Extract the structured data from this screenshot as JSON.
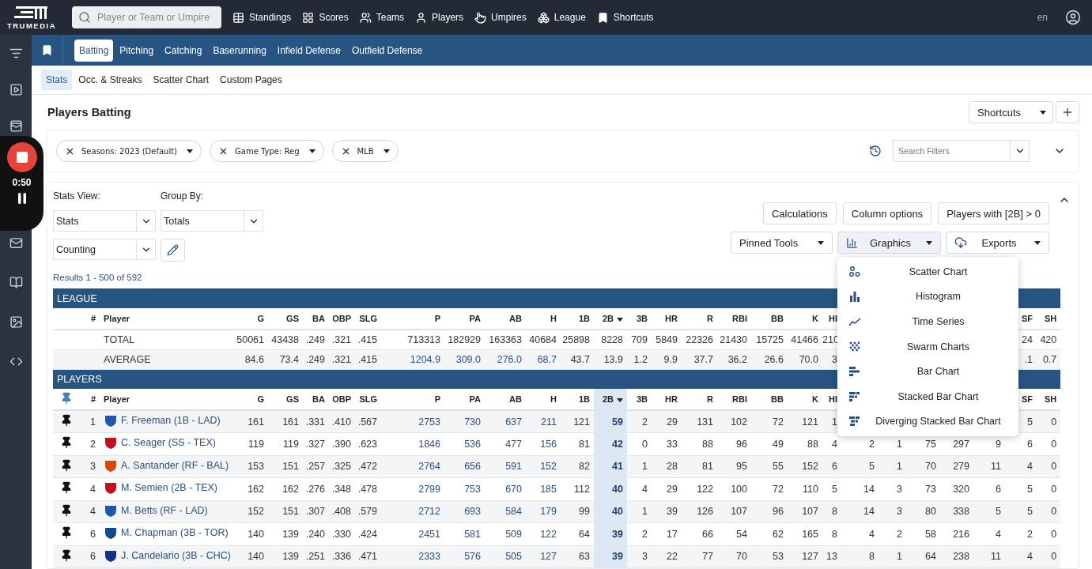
{
  "logo": "TRUMEDIA",
  "search": {
    "placeholder": "Player or Team or Umpire"
  },
  "top_nav": [
    {
      "label": "Standings"
    },
    {
      "label": "Scores"
    },
    {
      "label": "Teams"
    },
    {
      "label": "Players"
    },
    {
      "label": "Umpires"
    },
    {
      "label": "League"
    },
    {
      "label": "Shortcuts"
    }
  ],
  "language": "en",
  "recorder": {
    "time": "0:50"
  },
  "section_tabs": [
    {
      "label": "Batting",
      "selected": true
    },
    {
      "label": "Pitching",
      "selected": false
    },
    {
      "label": "Catching",
      "selected": false
    },
    {
      "label": "Baserunning",
      "selected": false
    },
    {
      "label": "Infield Defense",
      "selected": false
    },
    {
      "label": "Outfield Defense",
      "selected": false
    }
  ],
  "sub_tabs": [
    {
      "label": "Stats",
      "selected": true
    },
    {
      "label": "Occ. & Streaks",
      "selected": false
    },
    {
      "label": "Scatter Chart",
      "selected": false
    },
    {
      "label": "Custom Pages",
      "selected": false
    }
  ],
  "page_title": "Players Batting",
  "shortcuts_button": "Shortcuts",
  "filters": [
    {
      "label": "Seasons: 2023 (Default)"
    },
    {
      "label": "Game Type: Reg"
    },
    {
      "label": "MLB"
    }
  ],
  "filter_search": {
    "placeholder": "Search Filters"
  },
  "stats_view": {
    "label": "Stats View:",
    "value": "Stats"
  },
  "group_by": {
    "label": "Group By:",
    "value": "Totals"
  },
  "stat_type": {
    "value": "Counting"
  },
  "actions": [
    "Calculations",
    "Column options",
    "Players with [2B] > 0"
  ],
  "tools": [
    {
      "label": "Pinned Tools",
      "kind": "plain",
      "expanded": false
    },
    {
      "label": "Graphics",
      "kind": "graphics",
      "expanded": true
    },
    {
      "label": "Exports",
      "kind": "export",
      "expanded": false
    }
  ],
  "graphics_menu": [
    {
      "label": "Scatter Chart",
      "kind": "scatter"
    },
    {
      "label": "Histogram",
      "kind": "histogram"
    },
    {
      "label": "Time Series",
      "kind": "line"
    },
    {
      "label": "Swarm Charts",
      "kind": "swarm"
    },
    {
      "label": "Bar Chart",
      "kind": "bar"
    },
    {
      "label": "Stacked Bar Chart",
      "kind": "stacked"
    },
    {
      "label": "Diverging Stacked Bar Chart",
      "kind": "diverging"
    }
  ],
  "results": "Results 1 - 500 of 592",
  "league": {
    "title": "LEAGUE",
    "number_heading": "#",
    "player_heading": "Player",
    "columns": [
      {
        "label": "G",
        "sorted": false
      },
      {
        "label": "GS",
        "sorted": false
      },
      {
        "label": "BA",
        "sorted": false
      },
      {
        "label": "OBP",
        "sorted": false
      },
      {
        "label": "SLG",
        "sorted": false
      },
      {
        "label": "P",
        "sorted": false
      },
      {
        "label": "PA",
        "sorted": false
      },
      {
        "label": "AB",
        "sorted": false
      },
      {
        "label": "H",
        "sorted": false
      },
      {
        "label": "1B",
        "sorted": false
      },
      {
        "label": "2B",
        "sorted": true
      },
      {
        "label": "3B",
        "sorted": false
      },
      {
        "label": "HR",
        "sorted": false
      },
      {
        "label": "R",
        "sorted": false
      },
      {
        "label": "RBI",
        "sorted": false
      },
      {
        "label": "BB",
        "sorted": false
      },
      {
        "label": "K",
        "sorted": false
      },
      {
        "label": "HI",
        "sorted": false
      }
    ],
    "end_columns": [
      {
        "label": "SF",
        "sorted": false
      },
      {
        "label": "SH",
        "sorted": false
      }
    ],
    "rows": [
      {
        "kind": "total",
        "label": "TOTAL",
        "values": [
          "50061",
          "43438",
          ".249",
          ".321",
          ".415",
          "713313",
          "182929",
          "163363",
          "40684",
          "25898",
          "8228",
          "709",
          "5849",
          "22326",
          "21430",
          "15725",
          "41466",
          "210"
        ],
        "end_values": [
          "24",
          "420"
        ]
      },
      {
        "kind": "average",
        "label": "AVERAGE",
        "values": [
          "84.6",
          "73.4",
          ".249",
          ".321",
          ".415",
          "1204.9",
          "309.0",
          "276.0",
          "68.7",
          "43.7",
          "13.9",
          "1.2",
          "9.9",
          "37.7",
          "36.2",
          "26.6",
          "70.0",
          "3"
        ],
        "end_values": [
          ".1",
          "0.7"
        ]
      }
    ]
  },
  "players": {
    "title": "PLAYERS",
    "number_heading": "#",
    "player_heading": "Player",
    "columns": [
      {
        "label": "G",
        "sorted": false
      },
      {
        "label": "GS",
        "sorted": false
      },
      {
        "label": "BA",
        "sorted": false
      },
      {
        "label": "OBP",
        "sorted": false
      },
      {
        "label": "SLG",
        "sorted": false
      },
      {
        "label": "P",
        "sorted": false
      },
      {
        "label": "PA",
        "sorted": false
      },
      {
        "label": "AB",
        "sorted": false
      },
      {
        "label": "H",
        "sorted": false
      },
      {
        "label": "1B",
        "sorted": false
      },
      {
        "label": "2B",
        "sorted": true
      },
      {
        "label": "3B",
        "sorted": false
      },
      {
        "label": "HR",
        "sorted": false
      },
      {
        "label": "R",
        "sorted": false
      },
      {
        "label": "RBI",
        "sorted": false
      },
      {
        "label": "BB",
        "sorted": false
      },
      {
        "label": "K",
        "sorted": false
      },
      {
        "label": "HI",
        "sorted": false
      }
    ],
    "end_columns": [
      {
        "label": "SF",
        "sorted": false
      },
      {
        "label": "SH",
        "sorted": false
      }
    ],
    "rows": [
      {
        "rank": "1",
        "name": "F. Freeman (1B - LAD)",
        "color": "#1e5aa8",
        "pinned": true,
        "values": [
          "161",
          "161",
          ".331",
          ".410",
          ".567",
          "2753",
          "730",
          "637",
          "211",
          "121",
          "59",
          "2",
          "29",
          "131",
          "102",
          "72",
          "121",
          "1"
        ],
        "end_values": [
          "5",
          "0"
        ]
      },
      {
        "rank": "2",
        "name": "C. Seager (SS - TEX)",
        "color": "#c0111f",
        "pinned": true,
        "values": [
          "119",
          "119",
          ".327",
          ".390",
          ".623",
          "1846",
          "536",
          "477",
          "156",
          "81",
          "42",
          "0",
          "33",
          "88",
          "96",
          "49",
          "88",
          "4",
          "2",
          "1",
          "75",
          "297",
          "9"
        ],
        "end_values": [
          "6",
          "0"
        ]
      },
      {
        "rank": "3",
        "name": "A. Santander (RF - BAL)",
        "color": "#df4601",
        "pinned": true,
        "values": [
          "153",
          "151",
          ".257",
          ".325",
          ".472",
          "2764",
          "656",
          "591",
          "152",
          "82",
          "41",
          "1",
          "28",
          "81",
          "95",
          "55",
          "152",
          "6",
          "5",
          "1",
          "70",
          "279",
          "11"
        ],
        "end_values": [
          "4",
          "0"
        ]
      },
      {
        "rank": "4",
        "name": "M. Semien (2B - TEX)",
        "color": "#c0111f",
        "pinned": true,
        "values": [
          "162",
          "162",
          ".276",
          ".348",
          ".478",
          "2799",
          "753",
          "670",
          "185",
          "112",
          "40",
          "4",
          "29",
          "122",
          "100",
          "72",
          "110",
          "5",
          "14",
          "3",
          "73",
          "320",
          "6"
        ],
        "end_values": [
          "5",
          "0"
        ]
      },
      {
        "rank": "4",
        "name": "M. Betts (RF - LAD)",
        "color": "#1e5aa8",
        "pinned": true,
        "values": [
          "152",
          "151",
          ".307",
          ".408",
          ".579",
          "2712",
          "693",
          "584",
          "179",
          "99",
          "40",
          "1",
          "39",
          "126",
          "107",
          "96",
          "107",
          "8",
          "14",
          "3",
          "80",
          "338",
          "5"
        ],
        "end_values": [
          "5",
          "0"
        ]
      },
      {
        "rank": "6",
        "name": "M. Chapman (3B - TOR)",
        "color": "#134a8e",
        "pinned": true,
        "values": [
          "140",
          "139",
          ".240",
          ".330",
          ".424",
          "2451",
          "581",
          "509",
          "122",
          "64",
          "39",
          "2",
          "17",
          "66",
          "54",
          "62",
          "165",
          "8",
          "4",
          "2",
          "58",
          "216",
          "4"
        ],
        "end_values": [
          "2",
          "0"
        ]
      },
      {
        "rank": "6",
        "name": "J. Candelario (3B - CHC)",
        "color": "#0e3386",
        "pinned": true,
        "values": [
          "140",
          "139",
          ".251",
          ".336",
          ".471",
          "2333",
          "576",
          "505",
          "127",
          "63",
          "39",
          "3",
          "22",
          "77",
          "70",
          "53",
          "127",
          "13",
          "8",
          "1",
          "64",
          "238",
          "11"
        ],
        "end_values": [
          "4",
          "0"
        ]
      }
    ]
  }
}
